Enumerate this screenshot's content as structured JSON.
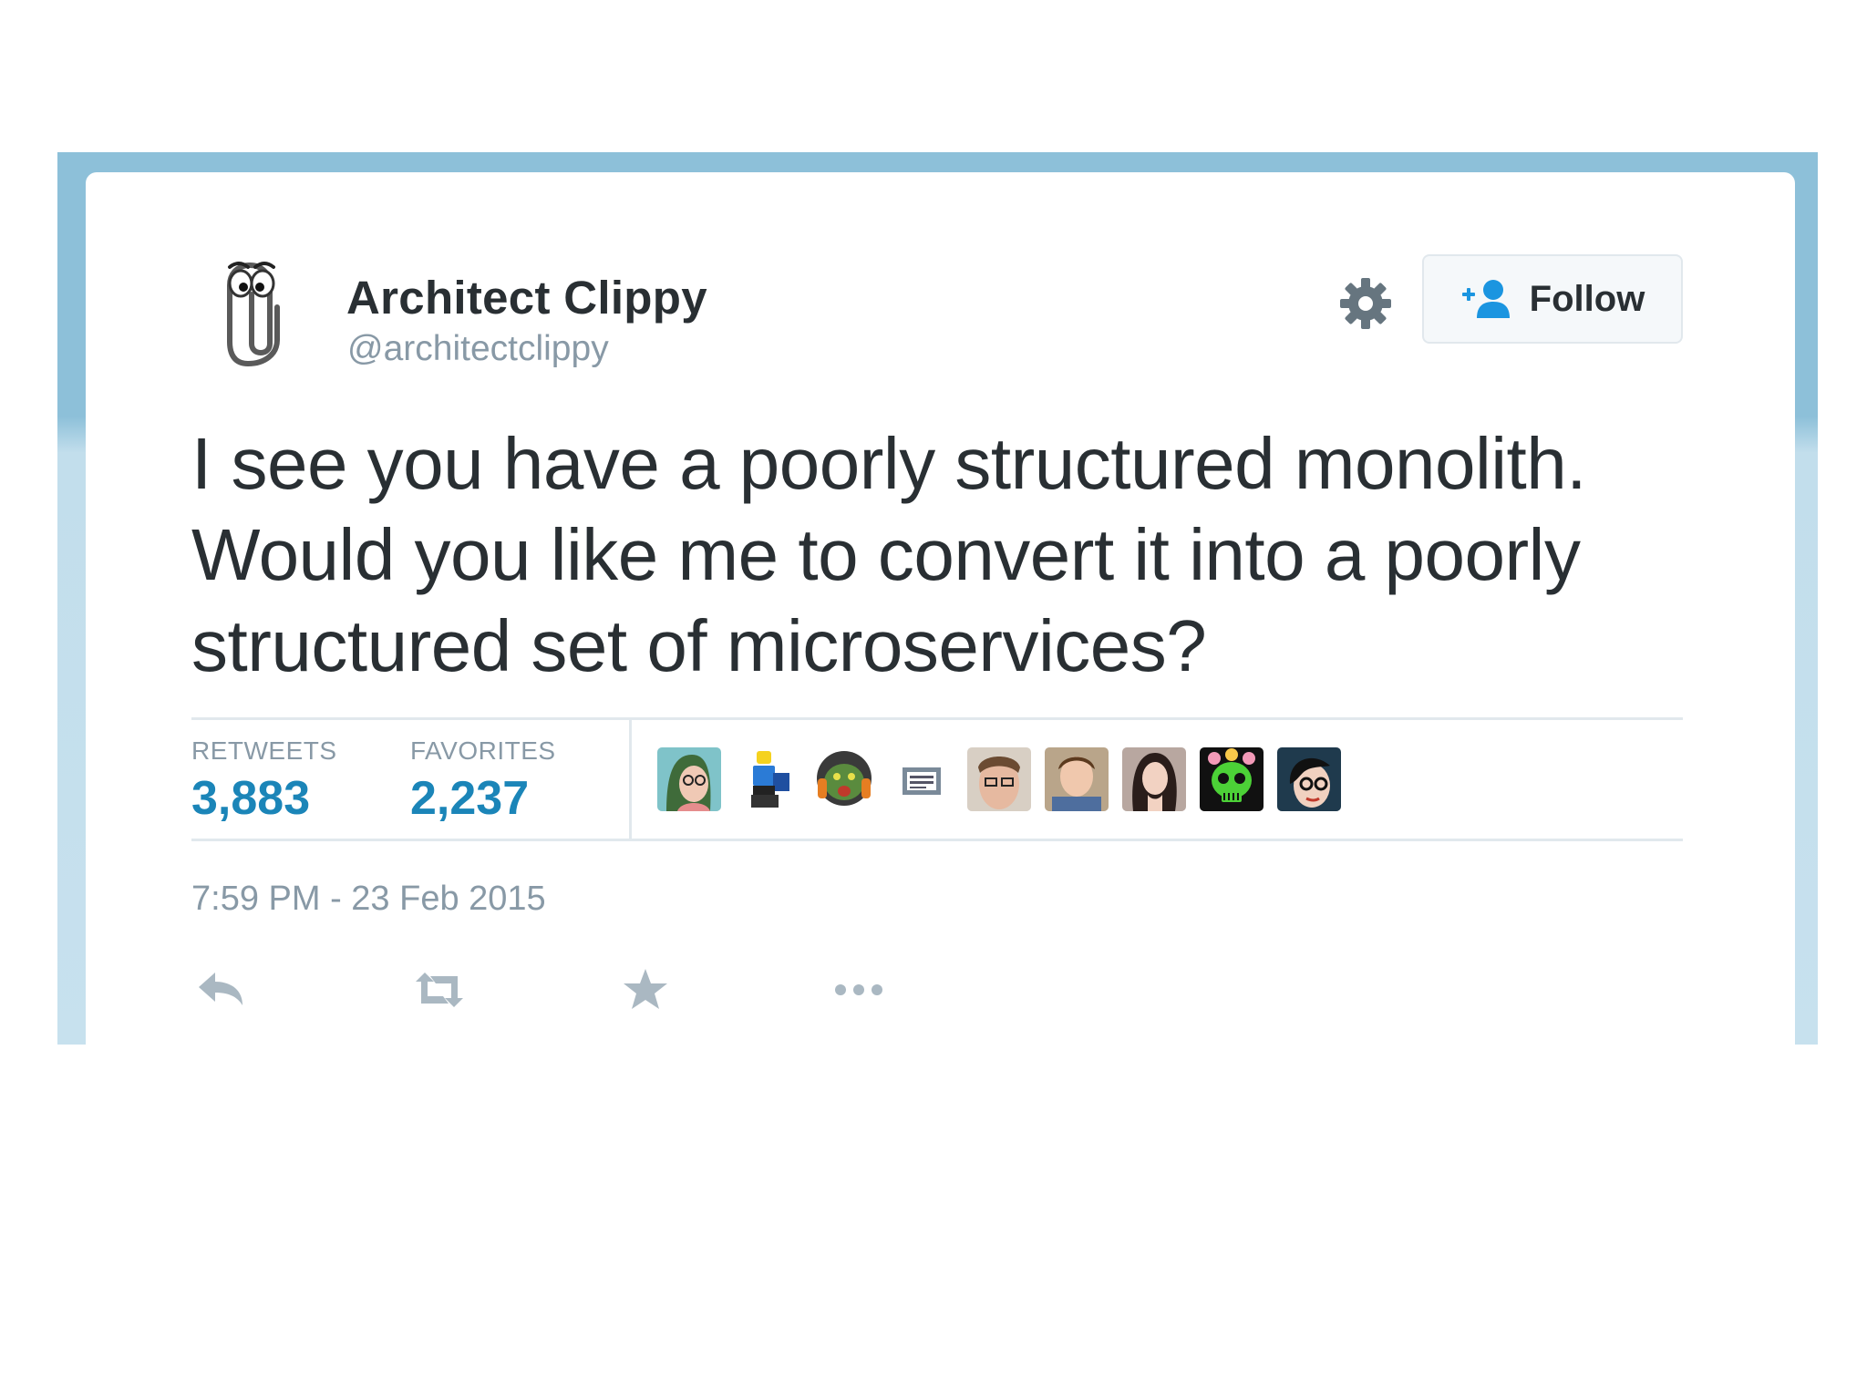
{
  "tweet": {
    "display_name": "Architect Clippy",
    "handle": "@architectclippy",
    "text": "I see you have a poorly structured monolith. Would you like me to convert it into a poorly structured set of microservices?",
    "timestamp": "7:59 PM - 23 Feb 2015"
  },
  "header": {
    "follow_label": "Follow",
    "settings_icon": "gear-icon",
    "follow_icon": "add-user-icon"
  },
  "stats": {
    "retweets_label": "RETWEETS",
    "retweets_count": "3,883",
    "favorites_label": "FAVORITES",
    "favorites_count": "2,237"
  },
  "favoriters": [
    "avatar-1",
    "avatar-2",
    "avatar-3",
    "avatar-4",
    "avatar-5",
    "avatar-6",
    "avatar-7",
    "avatar-8",
    "avatar-9"
  ],
  "actions": [
    "reply-icon",
    "retweet-icon",
    "favorite-star-icon",
    "more-icon"
  ],
  "colors": {
    "accent": "#1b85b8",
    "text": "#292f33",
    "muted": "#8899a6",
    "border": "#e1e8ed",
    "backdrop": "#8dc0d9"
  }
}
